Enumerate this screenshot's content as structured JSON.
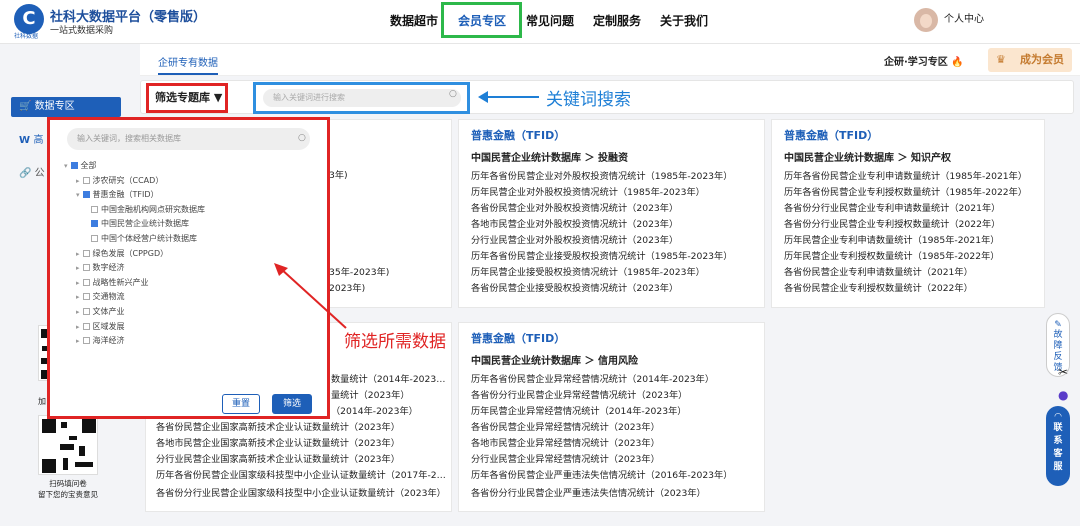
{
  "header": {
    "logo_text": "C",
    "logo_sub": "社科数据",
    "brand_title": "社科大数据平台（零售版）",
    "brand_sub": "一站式数据采购",
    "nav": [
      "数据超市",
      "会员专区",
      "常见问题",
      "定制服务",
      "关于我们"
    ],
    "active_nav": "会员专区",
    "user_label": "个人中心"
  },
  "sidebar": {
    "items": [
      "数据专区",
      "高",
      "公"
    ],
    "qr1_label": "加",
    "qr2_label1": "扫码填问卷",
    "qr2_label2": "留下您的宝贵意见"
  },
  "subhead": {
    "tab": "企研专有数据",
    "study_zone": "企研·学习专区 🔥",
    "member_button": "成为会员"
  },
  "filter": {
    "dropdown_label": "筛选专题库 ▼",
    "search_placeholder": "输入关键词进行搜索",
    "annotation_search": "关键词搜索",
    "annotation_filter": "筛选所需数据"
  },
  "panel": {
    "search_placeholder": "输入关键词，搜索相关数据库",
    "tree": [
      {
        "label": "全部",
        "indent": 0,
        "state": "half"
      },
      {
        "label": "涉农研究（CCAD）",
        "indent": 1,
        "state": "off"
      },
      {
        "label": "普惠金融（TFID）",
        "indent": 1,
        "state": "half"
      },
      {
        "label": "中国金融机构网点研究数据库",
        "indent": 2,
        "state": "off"
      },
      {
        "label": "中国民营企业统计数据库",
        "indent": 2,
        "state": "on"
      },
      {
        "label": "中国个体经营户统计数据库",
        "indent": 2,
        "state": "off"
      },
      {
        "label": "绿色发展（CPPGD）",
        "indent": 1,
        "state": "off"
      },
      {
        "label": "数字经济",
        "indent": 1,
        "state": "off"
      },
      {
        "label": "战略性新兴产业",
        "indent": 1,
        "state": "off"
      },
      {
        "label": "交通物流",
        "indent": 1,
        "state": "off"
      },
      {
        "label": "文体产业",
        "indent": 1,
        "state": "off"
      },
      {
        "label": "区域发展",
        "indent": 1,
        "state": "off"
      },
      {
        "label": "海洋经济",
        "indent": 1,
        "state": "off"
      }
    ],
    "reset_label": "重置",
    "apply_label": "筛选"
  },
  "cards": {
    "c1": {
      "title": "",
      "subtitle": "",
      "items": [
        "3年)",
        "",
        "",
        "",
        "",
        "35年-2023年)",
        "2023年)"
      ]
    },
    "c2": {
      "title": "普惠金融（TFID）",
      "subtitle": "中国民营企业统计数据库 ＞ 投融资",
      "items": [
        "历年各省份民营企业对外股权投资情况统计（1985年-2023年）",
        "历年民营企业对外股权投资情况统计（1985年-2023年）",
        "各省份民营企业对外股权投资情况统计（2023年）",
        "各地市民营企业对外股权投资情况统计（2023年）",
        "分行业民营企业对外股权投资情况统计（2023年）",
        "历年各省份民营企业接受股权投资情况统计（1985年-2023年）",
        "历年民营企业接受股权投资情况统计（1985年-2023年）",
        "各省份民营企业接受股权投资情况统计（2023年）"
      ]
    },
    "c3": {
      "title": "普惠金融（TFID）",
      "subtitle": "中国民营企业统计数据库 ＞ 知识产权",
      "items": [
        "历年各省份民营企业专利申请数量统计（1985年-2021年）",
        "历年各省份民营企业专利授权数量统计（1985年-2022年）",
        "各省份分行业民营企业专利申请数量统计（2021年）",
        "各省份分行业民营企业专利授权数量统计（2022年）",
        "历年民营企业专利申请数量统计（1985年-2021年）",
        "历年民营企业专利授权数量统计（1985年-2022年）",
        "各省份民营企业专利申请数量统计（2021年）",
        "各省份民营企业专利授权数量统计（2022年）"
      ]
    },
    "c4": {
      "items": [
        "数量统计（2014年-2023…",
        "量统计（2023年）",
        "（2014年-2023年）",
        "各省份民营企业国家高新技术企业认证数量统计（2023年）",
        "各地市民营企业国家高新技术企业认证数量统计（2023年）",
        "分行业民营企业国家高新技术企业认证数量统计（2023年）",
        "历年各省份民营企业国家级科技型中小企业认证数量统计（2017年-2…",
        "各省份分行业民营企业国家级科技型中小企业认证数量统计（2023年）"
      ]
    },
    "c5": {
      "title": "普惠金融（TFID）",
      "subtitle": "中国民营企业统计数据库 ＞ 信用风险",
      "items": [
        "历年各省份民营企业异常经营情况统计（2014年-2023年）",
        "各省份分行业民营企业异常经营情况统计（2023年）",
        "历年民营企业异常经营情况统计（2014年-2023年）",
        "各省份民营企业异常经营情况统计（2023年）",
        "各地市民营企业异常经营情况统计（2023年）",
        "分行业民营企业异常经营情况统计（2023年）",
        "历年各省份民营企业严重违法失信情况统计（2016年-2023年）",
        "各省份分行业民营企业严重违法失信情况统计（2023年）"
      ]
    }
  },
  "floating": {
    "feedback": "故障反馈",
    "contact": "联系客服"
  },
  "colors": {
    "brand_blue": "#1e5fb8",
    "highlight_red": "#e02424",
    "highlight_green": "#2db84a",
    "highlight_blue": "#2f8fe0"
  }
}
